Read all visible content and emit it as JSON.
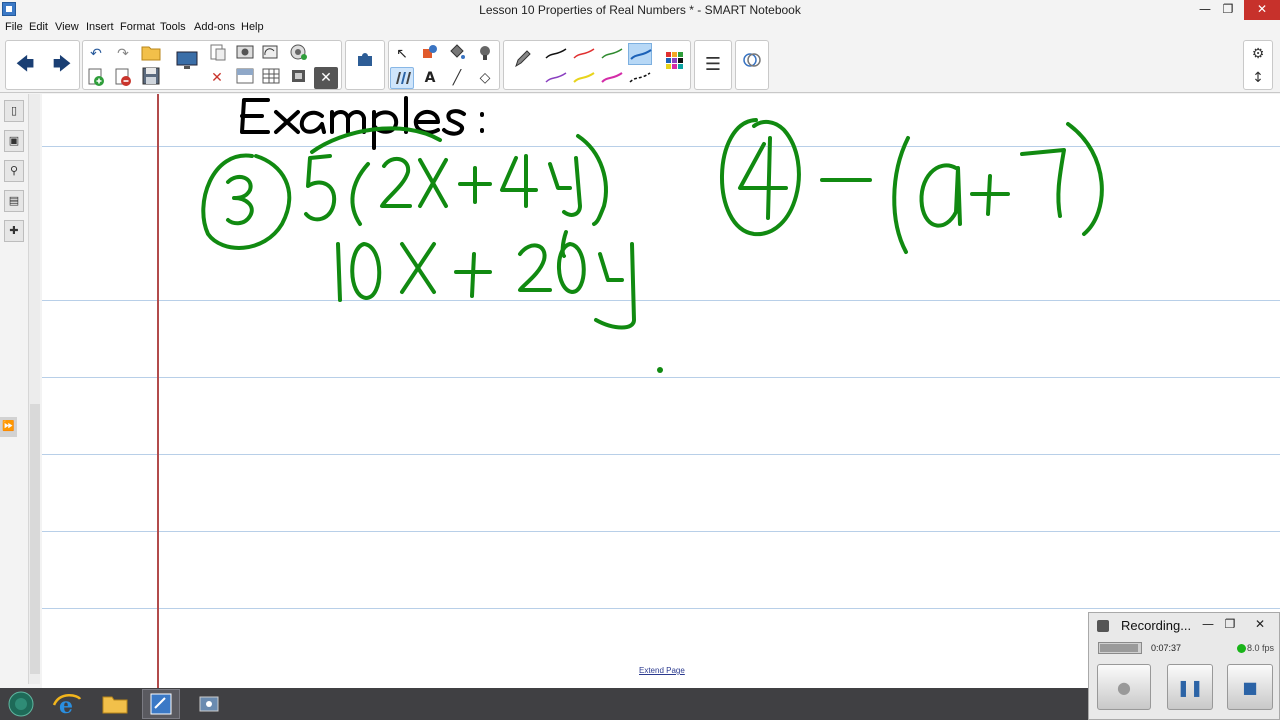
{
  "window": {
    "title": "Lesson 10 Properties of Real Numbers * - SMART Notebook",
    "minimize": "—",
    "restore": "❐",
    "close": "✕"
  },
  "menu": {
    "items": [
      "File",
      "Edit",
      "View",
      "Insert",
      "Format",
      "Tools",
      "Add-ons",
      "Help"
    ]
  },
  "toolbar": {
    "back": "🡄",
    "forward": "🡆",
    "undo": "↶",
    "redo": "↷",
    "select": "↖",
    "text_tool": "A",
    "line_tool": "╱",
    "eraser": "◇",
    "properties": "☰",
    "gear": "⚙",
    "move_toolbar": "↕",
    "delete": "✕"
  },
  "sidebar": {
    "collapse_label": "⏩"
  },
  "canvas": {
    "extend_page": "Extend Page",
    "ink_color": "#118a11",
    "title_ink_color": "#000000"
  },
  "recorder": {
    "title": "Recording...",
    "time": "0:07:37",
    "fps": "8.0 fps",
    "pause": "❚❚",
    "stop": "■"
  }
}
